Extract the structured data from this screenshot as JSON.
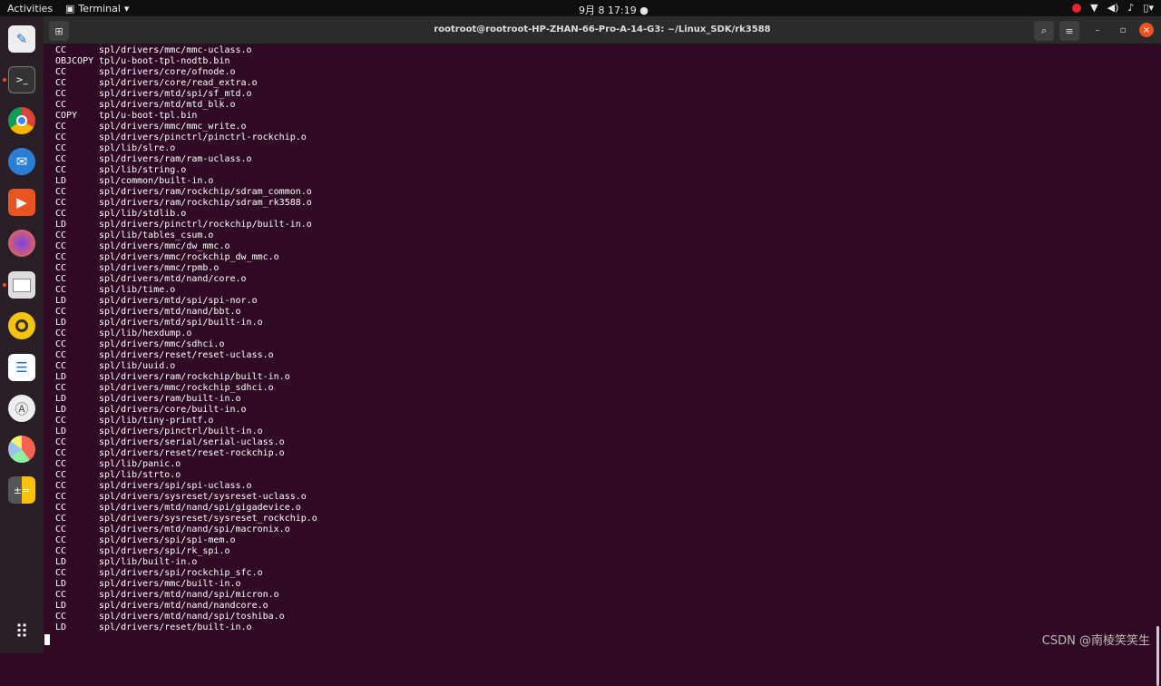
{
  "topbar": {
    "activities": "Activities",
    "app": "Terminal",
    "clock": "9月 8  17:19"
  },
  "window": {
    "title": "rootroot@rootroot-HP-ZHAN-66-Pro-A-14-G3: ~/Linux_SDK/rk3588"
  },
  "dock": [
    "Text Editor",
    "Terminal",
    "Chrome",
    "Thunderbird",
    "Software",
    "Firefox",
    "Files",
    "Rhythmbox",
    "LibreOffice Writer",
    "Ubuntu Software",
    "Disk Usage",
    "Calculator",
    "Show Applications"
  ],
  "lines": [
    [
      "CC",
      "spl/drivers/mmc/mmc-uclass.o"
    ],
    [
      "OBJCOPY",
      "tpl/u-boot-tpl-nodtb.bin"
    ],
    [
      "CC",
      "spl/drivers/core/ofnode.o"
    ],
    [
      "CC",
      "spl/drivers/core/read_extra.o"
    ],
    [
      "CC",
      "spl/drivers/mtd/spi/sf_mtd.o"
    ],
    [
      "CC",
      "spl/drivers/mtd/mtd_blk.o"
    ],
    [
      "COPY",
      "tpl/u-boot-tpl.bin"
    ],
    [
      "CC",
      "spl/drivers/mmc/mmc_write.o"
    ],
    [
      "CC",
      "spl/drivers/pinctrl/pinctrl-rockchip.o"
    ],
    [
      "CC",
      "spl/lib/slre.o"
    ],
    [
      "CC",
      "spl/drivers/ram/ram-uclass.o"
    ],
    [
      "CC",
      "spl/lib/string.o"
    ],
    [
      "LD",
      "spl/common/built-in.o"
    ],
    [
      "CC",
      "spl/drivers/ram/rockchip/sdram_common.o"
    ],
    [
      "CC",
      "spl/drivers/ram/rockchip/sdram_rk3588.o"
    ],
    [
      "CC",
      "spl/lib/stdlib.o"
    ],
    [
      "LD",
      "spl/drivers/pinctrl/rockchip/built-in.o"
    ],
    [
      "CC",
      "spl/lib/tables_csum.o"
    ],
    [
      "CC",
      "spl/drivers/mmc/dw_mmc.o"
    ],
    [
      "CC",
      "spl/drivers/mmc/rockchip_dw_mmc.o"
    ],
    [
      "CC",
      "spl/drivers/mmc/rpmb.o"
    ],
    [
      "CC",
      "spl/drivers/mtd/nand/core.o"
    ],
    [
      "CC",
      "spl/lib/time.o"
    ],
    [
      "LD",
      "spl/drivers/mtd/spi/spi-nor.o"
    ],
    [
      "CC",
      "spl/drivers/mtd/nand/bbt.o"
    ],
    [
      "LD",
      "spl/drivers/mtd/spi/built-in.o"
    ],
    [
      "CC",
      "spl/lib/hexdump.o"
    ],
    [
      "CC",
      "spl/drivers/mmc/sdhci.o"
    ],
    [
      "CC",
      "spl/drivers/reset/reset-uclass.o"
    ],
    [
      "CC",
      "spl/lib/uuid.o"
    ],
    [
      "LD",
      "spl/drivers/ram/rockchip/built-in.o"
    ],
    [
      "CC",
      "spl/drivers/mmc/rockchip_sdhci.o"
    ],
    [
      "LD",
      "spl/drivers/ram/built-in.o"
    ],
    [
      "LD",
      "spl/drivers/core/built-in.o"
    ],
    [
      "CC",
      "spl/lib/tiny-printf.o"
    ],
    [
      "LD",
      "spl/drivers/pinctrl/built-in.o"
    ],
    [
      "CC",
      "spl/drivers/serial/serial-uclass.o"
    ],
    [
      "CC",
      "spl/drivers/reset/reset-rockchip.o"
    ],
    [
      "CC",
      "spl/lib/panic.o"
    ],
    [
      "CC",
      "spl/lib/strto.o"
    ],
    [
      "CC",
      "spl/drivers/spi/spi-uclass.o"
    ],
    [
      "CC",
      "spl/drivers/sysreset/sysreset-uclass.o"
    ],
    [
      "CC",
      "spl/drivers/mtd/nand/spi/gigadevice.o"
    ],
    [
      "CC",
      "spl/drivers/sysreset/sysreset_rockchip.o"
    ],
    [
      "CC",
      "spl/drivers/mtd/nand/spi/macronix.o"
    ],
    [
      "CC",
      "spl/drivers/spi/spi-mem.o"
    ],
    [
      "CC",
      "spl/drivers/spi/rk_spi.o"
    ],
    [
      "LD",
      "spl/lib/built-in.o"
    ],
    [
      "CC",
      "spl/drivers/spi/rockchip_sfc.o"
    ],
    [
      "LD",
      "spl/drivers/mmc/built-in.o"
    ],
    [
      "CC",
      "spl/drivers/mtd/nand/spi/micron.o"
    ],
    [
      "LD",
      "spl/drivers/mtd/nand/nandcore.o"
    ],
    [
      "CC",
      "spl/drivers/mtd/nand/spi/toshiba.o"
    ],
    [
      "LD",
      "spl/drivers/reset/built-in.o"
    ]
  ],
  "watermark": "CSDN @南棱笑笑生"
}
